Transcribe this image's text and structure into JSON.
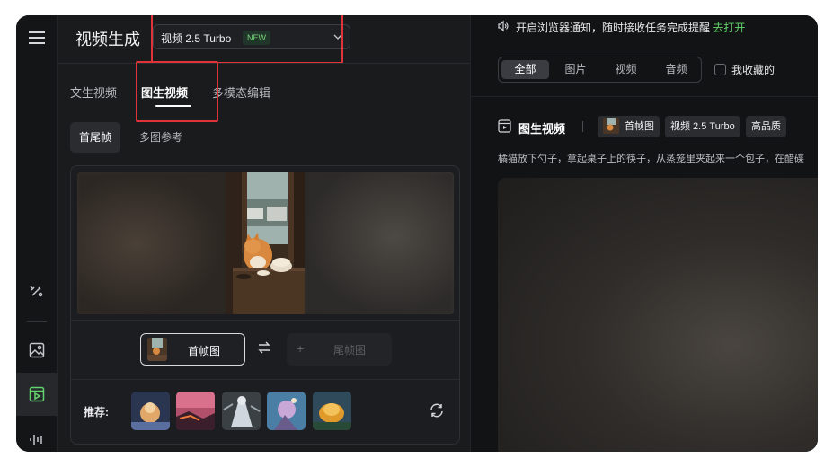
{
  "header": {
    "title": "视频生成",
    "model": {
      "label": "视频 2.5 Turbo",
      "badge": "NEW"
    }
  },
  "tabs": [
    {
      "label": "文生视频",
      "active": false
    },
    {
      "label": "图生视频",
      "active": true
    },
    {
      "label": "多模态编辑",
      "active": false
    }
  ],
  "subtabs": [
    {
      "label": "首尾帧",
      "active": true
    },
    {
      "label": "多图参考",
      "active": false
    }
  ],
  "frames": {
    "first_label": "首帧图",
    "last_label": "尾帧图"
  },
  "recommend": {
    "label": "推荐:"
  },
  "rail": {
    "icons": [
      "menu-icon",
      "brush-sparkle-icon",
      "image-icon",
      "video-icon",
      "audio-wave-icon"
    ]
  },
  "notice": {
    "text": "开启浏览器通知，随时接收任务完成提醒",
    "link": "去打开"
  },
  "filter": {
    "segments": [
      {
        "label": "全部",
        "active": true
      },
      {
        "label": "图片",
        "active": false
      },
      {
        "label": "视频",
        "active": false
      },
      {
        "label": "音频",
        "active": false
      }
    ],
    "favorites_label": "我收藏的"
  },
  "task": {
    "type_label": "图生视频",
    "chips": [
      "首帧图",
      "视频 2.5 Turbo",
      "高品质"
    ],
    "prompt": "橘猫放下勺子，拿起桌子上的筷子，从蒸笼里夹起来一个包子，在醋碟"
  },
  "colors": {
    "accent_green": "#63d46b",
    "highlight_red": "#e0343a",
    "new_badge_green": "#76d97a"
  }
}
